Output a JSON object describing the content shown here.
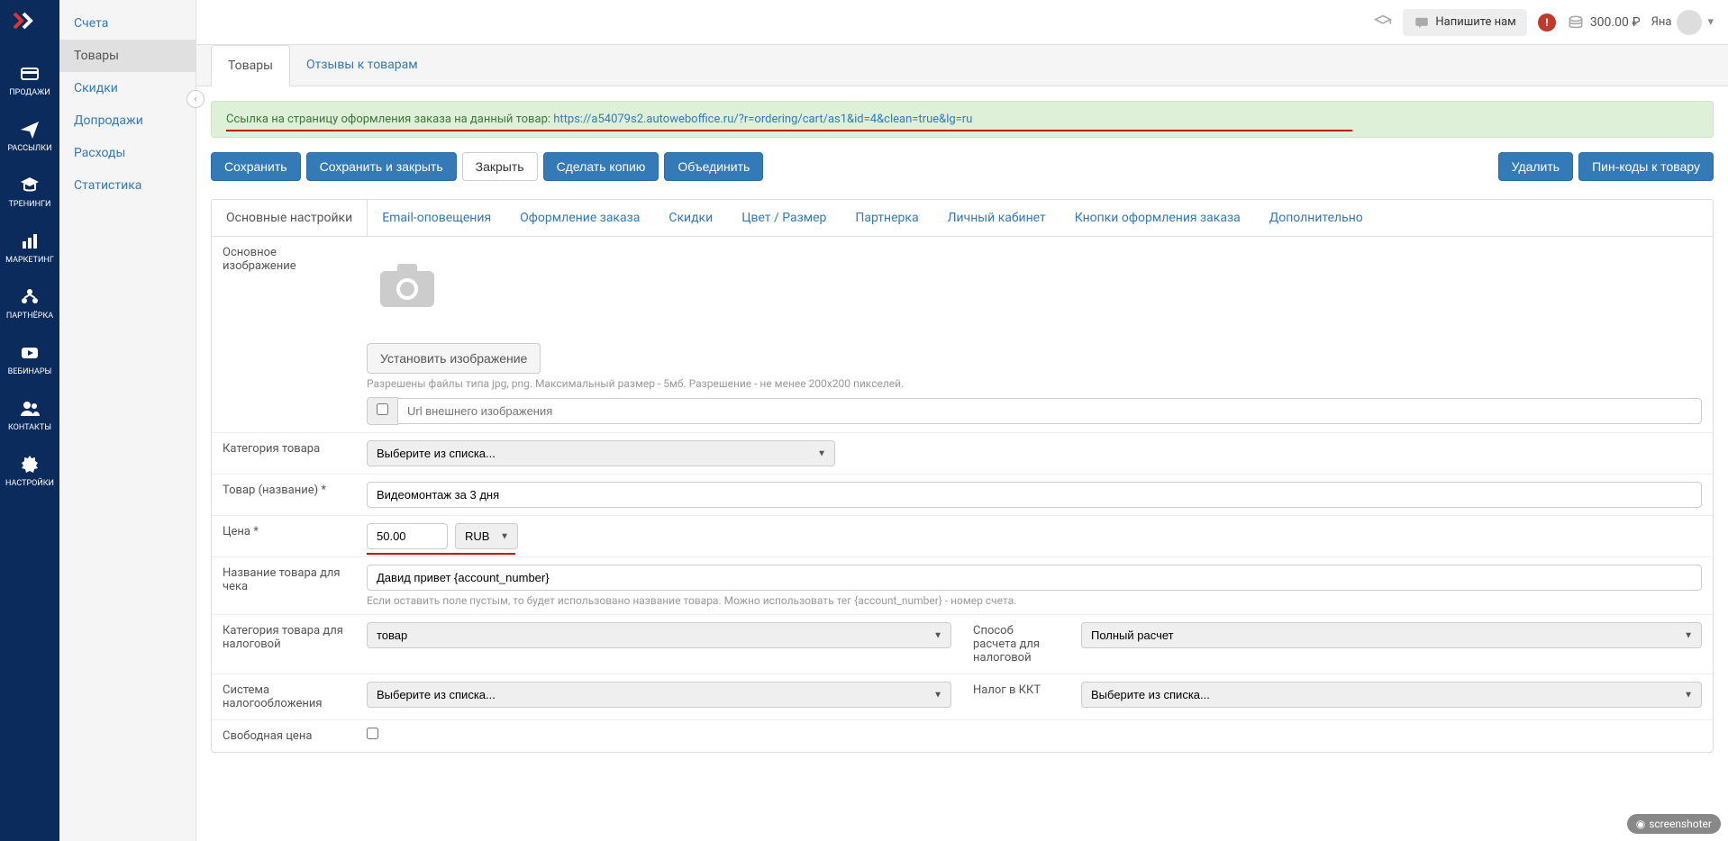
{
  "sidebar_main": [
    {
      "label": "ПРОДАЖИ",
      "icon": "card"
    },
    {
      "label": "РАССЫЛКИ",
      "icon": "send"
    },
    {
      "label": "ТРЕНИНГИ",
      "icon": "grad"
    },
    {
      "label": "МАРКЕТИНГ",
      "icon": "chart"
    },
    {
      "label": "ПАРТНЁРКА",
      "icon": "partner"
    },
    {
      "label": "ВЕБИНАРЫ",
      "icon": "play"
    },
    {
      "label": "КОНТАКТЫ",
      "icon": "users"
    },
    {
      "label": "НАСТРОЙКИ",
      "icon": "gear"
    }
  ],
  "sidebar_sub": [
    {
      "label": "Счета"
    },
    {
      "label": "Товары",
      "active": true
    },
    {
      "label": "Скидки"
    },
    {
      "label": "Допродажи"
    },
    {
      "label": "Расходы"
    },
    {
      "label": "Статистика"
    }
  ],
  "header": {
    "chat_label": "Напишите нам",
    "balance": "300.00 ₽",
    "username": "Яна",
    "alert": "!"
  },
  "top_tabs": [
    {
      "label": "Товары",
      "active": true
    },
    {
      "label": "Отзывы к товарам"
    }
  ],
  "alert": {
    "text": "Ссылка на страницу оформления заказа на данный товар: ",
    "link": "https://a54079s2.autoweboffice.ru/?r=ordering/cart/as1&id=4&clean=true&lg=ru"
  },
  "buttons": {
    "save": "Сохранить",
    "save_close": "Сохранить и закрыть",
    "close": "Закрыть",
    "copy": "Сделать копию",
    "merge": "Объединить",
    "delete": "Удалить",
    "pincodes": "Пин-коды к товару"
  },
  "inner_tabs": [
    {
      "label": "Основные настройки",
      "active": true
    },
    {
      "label": "Email-оповещения"
    },
    {
      "label": "Оформление заказа"
    },
    {
      "label": "Скидки"
    },
    {
      "label": "Цвет / Размер"
    },
    {
      "label": "Партнерка"
    },
    {
      "label": "Личный кабинет"
    },
    {
      "label": "Кнопки оформления заказа"
    },
    {
      "label": "Дополнительно"
    }
  ],
  "form": {
    "image_label": "Основное изображение",
    "set_image_btn": "Установить изображение",
    "image_help": "Разрешены файлы типа jpg, png. Максимальный размер - 5мб. Разрешение - не менее 200x200 пикселей.",
    "url_placeholder": "Url внешнего изображения",
    "category_label": "Категория товара",
    "category_placeholder": "Выберите из списка...",
    "name_label": "Товар (название) *",
    "name_value": "Видеомонтаж за 3 дня",
    "price_label": "Цена *",
    "price_value": "50.00",
    "currency": "RUB",
    "receipt_name_label": "Название товара для чека",
    "receipt_name_value": "Давид привет {account_number}",
    "receipt_help": "Если оставить поле пустым, то будет использовано название товара. Можно использовать тег {account_number} - номер счета.",
    "tax_category_label": "Категория товара для налоговой",
    "tax_category_value": "товар",
    "payment_method_label": "Способ расчета для налоговой",
    "payment_method_value": "Полный расчет",
    "tax_system_label": "Система налогообложения",
    "tax_system_placeholder": "Выберите из списка...",
    "kkt_tax_label": "Налог в ККТ",
    "kkt_tax_placeholder": "Выберите из списка...",
    "free_price_label": "Свободная цена"
  },
  "screenshoter": "screenshoter"
}
